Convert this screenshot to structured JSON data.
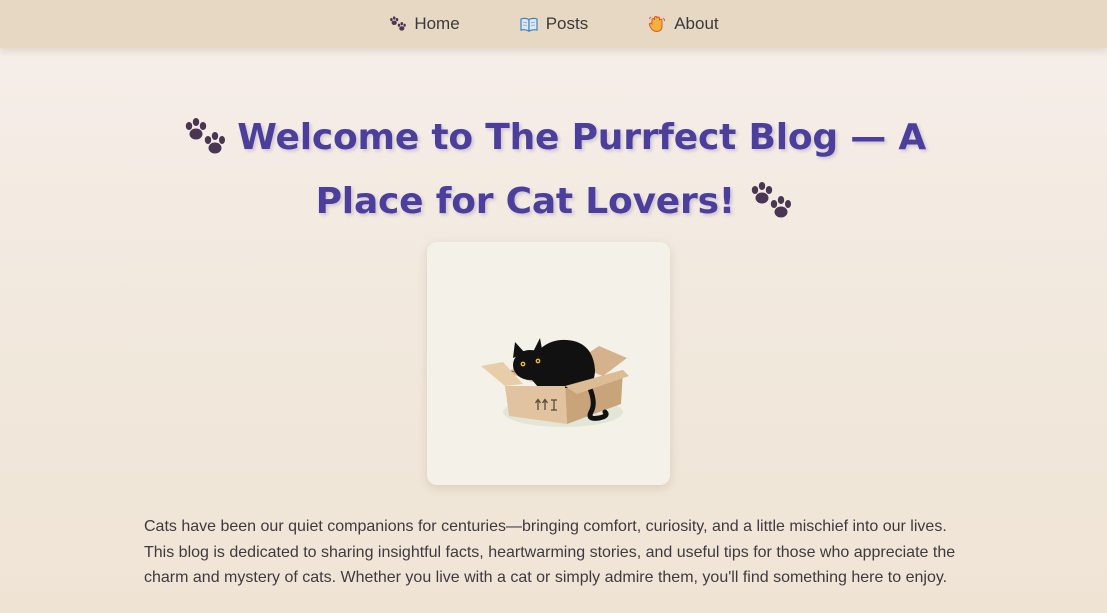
{
  "nav": {
    "items": [
      {
        "label": "Home",
        "icon": "paw-prints-icon"
      },
      {
        "label": "Posts",
        "icon": "open-book-icon"
      },
      {
        "label": "About",
        "icon": "waving-hand-icon"
      }
    ]
  },
  "hero": {
    "title": "Welcome to The Purrfect Blog — A Place for Cat Lovers!"
  },
  "image": {
    "description_icon": "cat-in-box-illustration"
  },
  "intro": {
    "text": "Cats have been our quiet companions for centuries—bringing comfort, curiosity, and a little mischief into our lives. This blog is dedicated to sharing insightful facts, heartwarming stories, and useful tips for those who appreciate the charm and mystery of cats. Whether you live with a cat or simply admire them, you'll find something here to enjoy."
  },
  "colors": {
    "nav_bg": "#e6d8c3",
    "title": "#4b3f9b",
    "paw": "#4a3552",
    "card_bg": "#f4f2e8"
  }
}
